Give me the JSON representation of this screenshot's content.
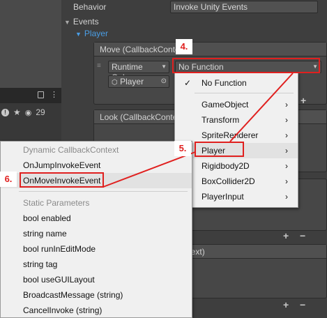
{
  "left_panel": {
    "icons": [
      "info-icon",
      "star-icon",
      "eye-icon"
    ],
    "eye_count": "29"
  },
  "inspector": {
    "behavior_label": "Behavior",
    "behavior_value": "Invoke Unity Events",
    "events_label": "Events",
    "player_label": "Player",
    "move_header": "Move (CallbackContext)",
    "runtime_value": "Runtime Only",
    "function_value": "No Function",
    "object_value": "Player",
    "look_header": "Look (CallbackContext)",
    "fire_header_tail": "ontext)",
    "plus": "+",
    "minus": "−"
  },
  "menu1": {
    "items": [
      {
        "label": "No Function",
        "checked": true,
        "submenu": false
      },
      {
        "label": "GameObject",
        "checked": false,
        "submenu": true
      },
      {
        "label": "Transform",
        "checked": false,
        "submenu": true
      },
      {
        "label": "SpriteRenderer",
        "checked": false,
        "submenu": true
      },
      {
        "label": "Player",
        "checked": false,
        "submenu": true
      },
      {
        "label": "Rigidbody2D",
        "checked": false,
        "submenu": true
      },
      {
        "label": "BoxCollider2D",
        "checked": false,
        "submenu": true
      },
      {
        "label": "PlayerInput",
        "checked": false,
        "submenu": true
      }
    ]
  },
  "menu2": {
    "dynamic_header": "Dynamic CallbackContext",
    "dynamic_items": [
      "OnJumpInvokeEvent",
      "OnMoveInvokeEvent"
    ],
    "static_header": "Static Parameters",
    "static_items": [
      "bool enabled",
      "string name",
      "bool runInEditMode",
      "string tag",
      "bool useGUILayout",
      "BroadcastMessage (string)",
      "CancelInvoke (string)"
    ]
  },
  "callouts": {
    "step4": "4.",
    "step5": "5.",
    "step6": "6."
  },
  "colors": {
    "highlight_red": "#e0201f",
    "player_blue": "#4a9ee6",
    "menu_bg": "#f0f0f0"
  }
}
